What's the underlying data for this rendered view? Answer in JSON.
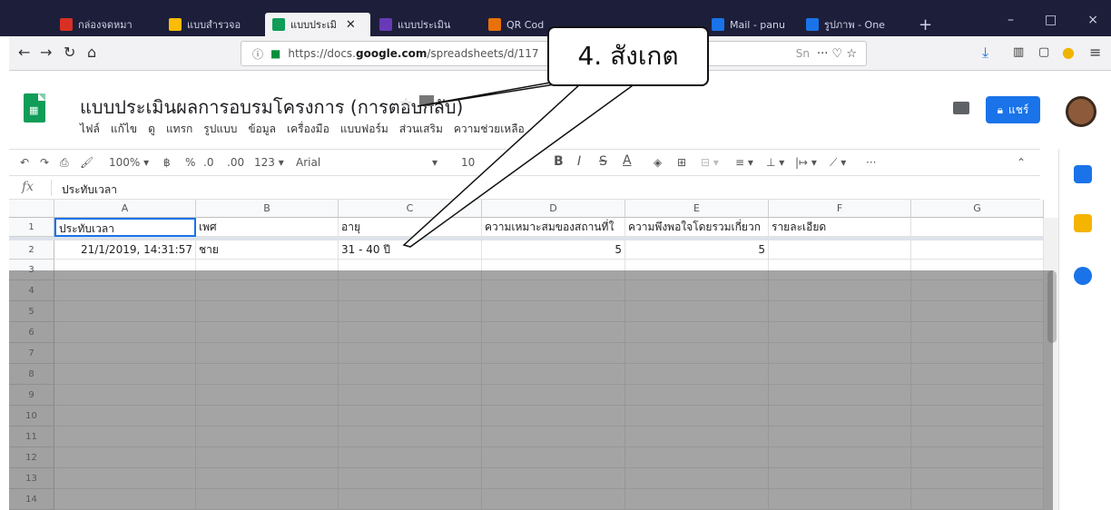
{
  "browser": {
    "tabs": [
      {
        "label": "กล่องจดหมา",
        "color": "#d93025"
      },
      {
        "label": "แบบสำรวจอ",
        "color": "#fbbc04"
      },
      {
        "label": "แบบประเมิ",
        "color": "#0f9d58"
      },
      {
        "label": "แบบประเมิน",
        "color": "#673ab7"
      },
      {
        "label": "QR Cod",
        "color": "#e8710a"
      },
      {
        "label": "Mail - panu",
        "color": "#1a73e8"
      },
      {
        "label": "รูปภาพ - One",
        "color": "#1a73e8"
      }
    ],
    "new_tab": "+",
    "minimize": "–",
    "maximize": "□",
    "close": "×",
    "url_prefix": "https://docs.",
    "url_domain": "google.com",
    "url_path": "/spreadsheets/d/117",
    "url_tail": "Sn",
    "page_actions": "··· ♡ ☆"
  },
  "sheets": {
    "doc_title": "แบบประเมินผลการอบรมโครงการ (การตอบกลับ)",
    "menu": [
      "ไฟล์",
      "แก้ไข",
      "ดู",
      "แทรก",
      "รูปแบบ",
      "ข้อมูล",
      "เครื่องมือ",
      "แบบฟอร์ม",
      "ส่วนเสริม",
      "ความช่วยเหลือ"
    ],
    "share_label": "แชร์",
    "toolbar": {
      "zoom": "100%",
      "currency": "฿",
      "percent": "%",
      "dec_less": ".0",
      "dec_more": ".00",
      "format": "123",
      "font": "Arial",
      "font_size": "10",
      "more": "···"
    },
    "formula_value": "ประทับเวลา",
    "columns": [
      "A",
      "B",
      "C",
      "D",
      "E",
      "F",
      "G"
    ],
    "rows": [
      [
        "ประทับเวลา",
        "เพศ",
        "อายุ",
        "ความเหมาะสมของสถานที่ใ",
        "ความพึงพอใจโดยรวมเกี่ยวก",
        "รายละเอียด",
        ""
      ],
      [
        "21/1/2019, 14:31:57",
        "ชาย",
        "31 - 40 ปี",
        "5",
        "5",
        "",
        ""
      ]
    ],
    "row_numbers": [
      "1",
      "2",
      "3",
      "4",
      "5",
      "6",
      "7",
      "8",
      "9",
      "10",
      "11",
      "12",
      "13",
      "14"
    ]
  },
  "callout": {
    "text": "4. สังเกต"
  }
}
